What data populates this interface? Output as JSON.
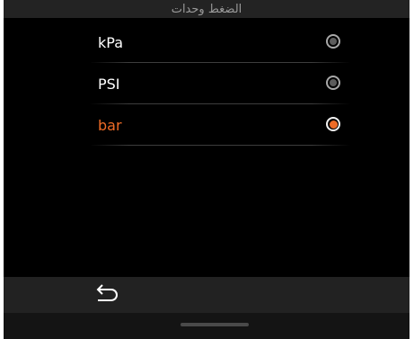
{
  "header": {
    "title": "الضغط وحدات"
  },
  "options": [
    {
      "label": "kPa",
      "selected": false
    },
    {
      "label": "PSI",
      "selected": false
    },
    {
      "label": "bar",
      "selected": true
    }
  ],
  "footer": {
    "back_icon": "return-arrow-icon"
  },
  "colors": {
    "accent": "#ee6b26",
    "background": "#000000",
    "bar": "#232323",
    "text": "#ffffff",
    "title_text": "#9a9a9a"
  }
}
